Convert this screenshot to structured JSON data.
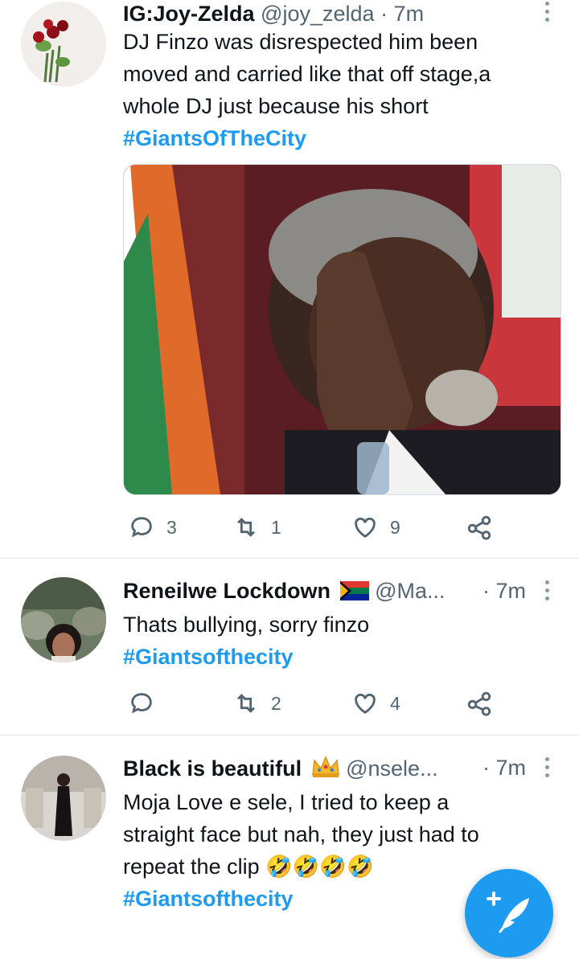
{
  "tweets": [
    {
      "name": "IG:Joy-Zelda",
      "handle": "@joy_zelda",
      "time": "· 7m",
      "text_lines": [
        "DJ Finzo was disrespected him been",
        "moved and carried like that off stage,a",
        "whole DJ just because his short"
      ],
      "hashtag": "#GiantsOfTheCity",
      "replies": "3",
      "retweets": "1",
      "likes": "9"
    },
    {
      "name": "Reneilwe Lockdown",
      "flag_icon": "south-africa-flag-icon",
      "handle": "@Ma...",
      "time": "· 7m",
      "text_lines": [
        "Thats bullying, sorry finzo"
      ],
      "hashtag": "#Giantsofthecity",
      "replies": "",
      "retweets": "2",
      "likes": "4"
    },
    {
      "name": "Black is beautiful",
      "crown_icon": "crown-emoji-icon",
      "handle": "@nsele...",
      "time": "· 7m",
      "text_lines": [
        "Moja Love e sele, I tried to keep a",
        "straight face but nah, they just had to",
        "repeat the clip"
      ],
      "emoji": "🤣🤣🤣🤣",
      "hashtag": "#Giantsofthecity"
    }
  ],
  "colors": {
    "accent": "#1d9bf0",
    "text": "#0f1419",
    "muted": "#536471"
  },
  "fab_icon": "compose-feather-icon"
}
